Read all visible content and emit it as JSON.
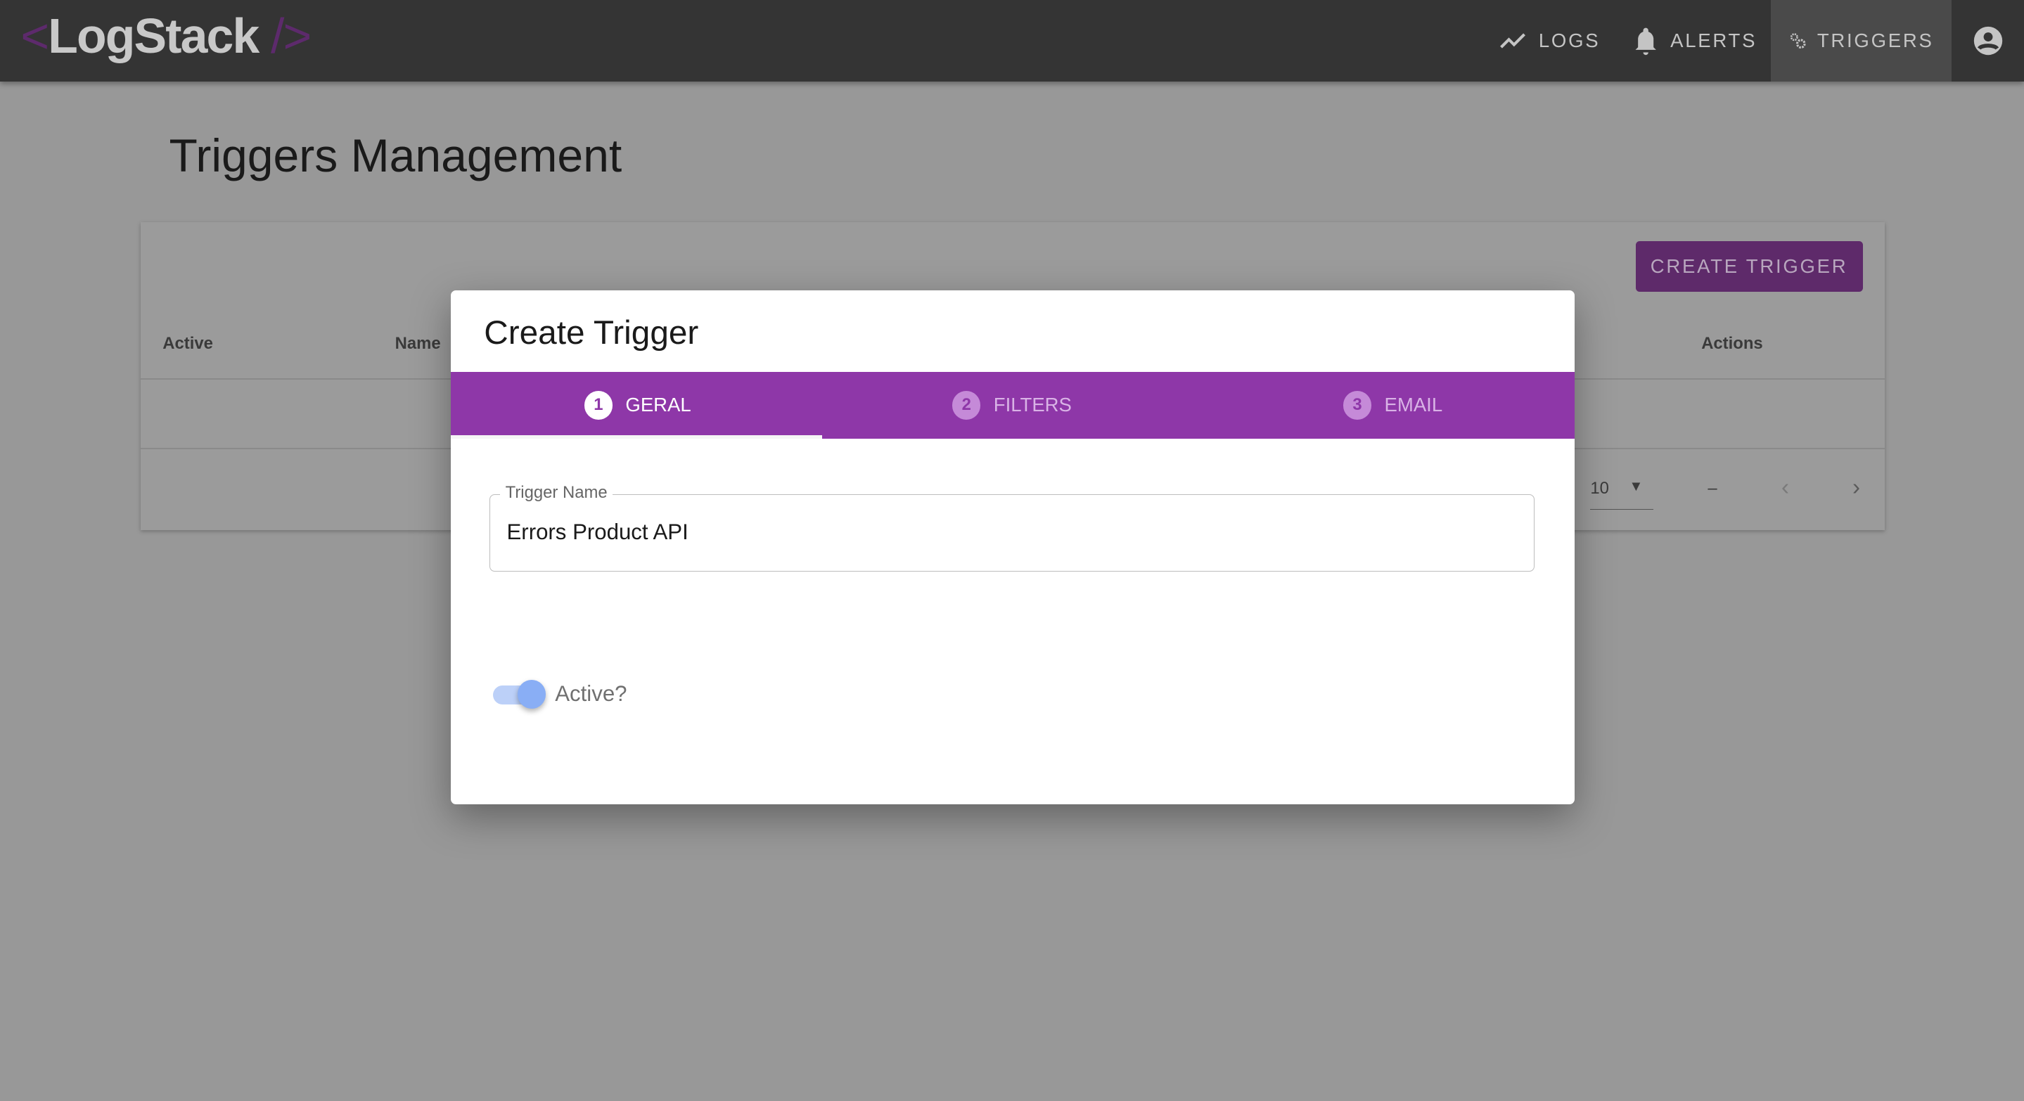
{
  "header": {
    "logo_open": "<",
    "logo_text": "LogStack",
    "logo_close": "/>",
    "nav": [
      {
        "label": "LOGS",
        "icon": "trend-icon"
      },
      {
        "label": "ALERTS",
        "icon": "bell-icon"
      },
      {
        "label": "TRIGGERS",
        "icon": "gears-icon",
        "active": true
      }
    ],
    "account_icon": "account-circle-icon"
  },
  "page": {
    "title": "Triggers Management",
    "create_button": "CREATE TRIGGER"
  },
  "table": {
    "columns": [
      "Active",
      "Name",
      "Actions"
    ],
    "pagination": {
      "rows_per_page": "10",
      "range": "–"
    }
  },
  "dialog": {
    "title": "Create Trigger",
    "steps": [
      {
        "num": "1",
        "label": "GERAL",
        "active": true
      },
      {
        "num": "2",
        "label": "FILTERS"
      },
      {
        "num": "3",
        "label": "EMAIL"
      }
    ],
    "trigger_name": {
      "label": "Trigger Name",
      "value": "Errors Product API"
    },
    "active_toggle": {
      "label": "Active?",
      "checked": true
    }
  },
  "colors": {
    "accent": "#8e37a8",
    "toggle": "#89aef5"
  }
}
